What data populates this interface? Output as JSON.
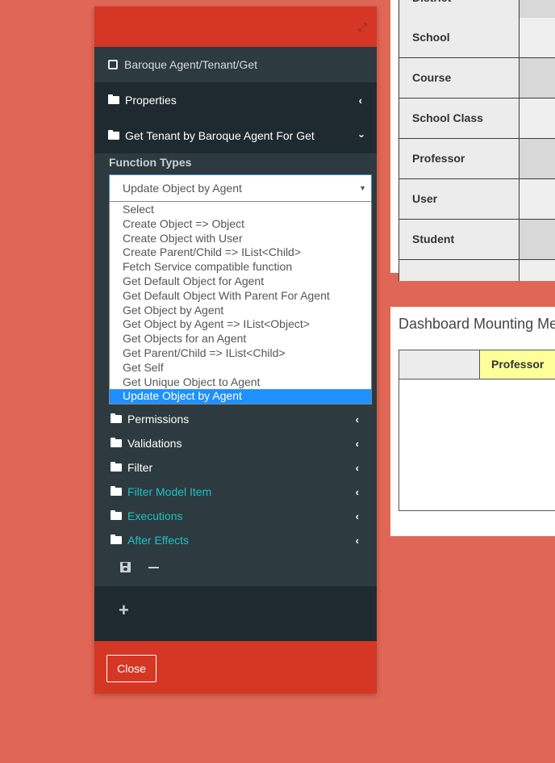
{
  "background_table": {
    "rows": [
      "District",
      "School",
      "Course",
      "School Class",
      "Professor",
      "User",
      "Student",
      ""
    ]
  },
  "dashboard": {
    "title": "Dashboard Mounting Me",
    "column_header": "Professor"
  },
  "modal": {
    "resize_icon": "resize-icon",
    "path": "Baroque Agent/Tenant/Get",
    "sections": {
      "properties": "Properties",
      "function": "Get Tenant by Baroque Agent For Get"
    },
    "function_types_label": "Function Types",
    "select_value": "Update Object by Agent",
    "options": [
      "Select",
      "Create Object => Object",
      "Create Object with User",
      "Create Parent/Child => IList<Child>",
      "Fetch Service compatible function",
      "Get Default Object for Agent",
      "Get Default Object With Parent For Agent",
      "Get Object by Agent",
      "Get Object by Agent => IList<Object>",
      "Get Objects for an Agent",
      "Get Parent/Child => IList<Child>",
      "Get Self",
      "Get Unique Object to Agent",
      "Update Object by Agent"
    ],
    "sub_sections": [
      {
        "label": "Permissions",
        "teal": false
      },
      {
        "label": "Validations",
        "teal": false
      },
      {
        "label": "Filter",
        "teal": false
      },
      {
        "label": "Filter Model Item",
        "teal": true
      },
      {
        "label": "Executions",
        "teal": true
      },
      {
        "label": "After Effects",
        "teal": true
      }
    ],
    "close_label": "Close"
  },
  "colors": {
    "page_bg": "#e06656",
    "modal_header": "#d63624",
    "modal_body": "#2d3a40",
    "section_bg": "#1f2a30",
    "teal_text": "#1fc2c2",
    "selected_option": "#1e90ff"
  }
}
